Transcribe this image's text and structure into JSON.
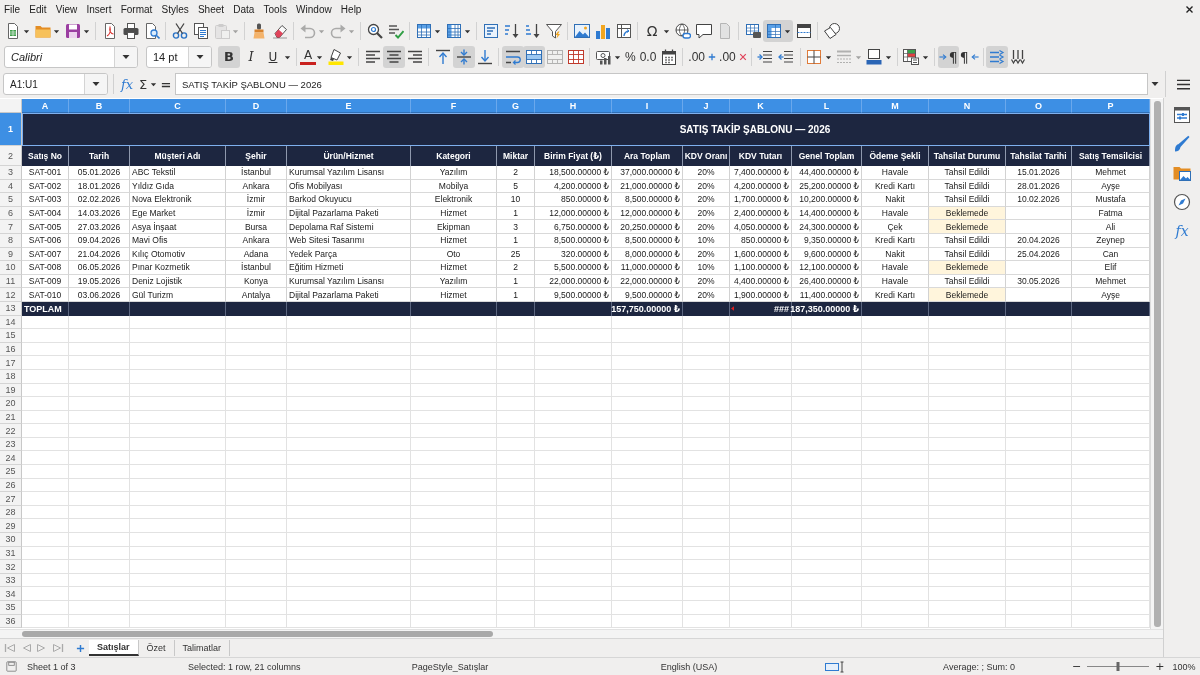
{
  "menu_bar": [
    "File",
    "Edit",
    "View",
    "Insert",
    "Format",
    "Styles",
    "Sheet",
    "Data",
    "Tools",
    "Window",
    "Help"
  ],
  "standard_toolbar": {
    "paste_disabled": true,
    "undo_disabled": true,
    "redo_disabled": true,
    "special_character_glyph": "Ω",
    "freeze_on": true
  },
  "formatting_toolbar": {
    "font_name": "Calibri",
    "font_size": "14 pt",
    "bold": {
      "glyph": "B",
      "on": true
    },
    "italic": {
      "glyph": "I",
      "on": false
    },
    "underline": {
      "glyph": "U",
      "on": false
    },
    "font_color_glyph": "A",
    "align_left": false,
    "align_center": true,
    "align_right": false,
    "align_top": false,
    "align_middle": true,
    "align_bottom": false,
    "wrap_text": true,
    "merge_and_center": true,
    "merge_cells_disabled": true,
    "percent_glyph": "%",
    "decimal_glyph": "0.0",
    "add_decimal_glyph": ".00",
    "delete_decimal_glyph": ".00",
    "border_style_disabled": true,
    "left_to_right": {
      "glyph": "¶",
      "on": true
    },
    "right_to_left": {
      "glyph": "¶",
      "on": false
    },
    "text_direction_horizontal": true,
    "text_direction_vertical": false
  },
  "formula_bar": {
    "name_box": "A1:U1",
    "function_glyph": "fx",
    "sum_glyph": "Σ",
    "equals_glyph": "=",
    "content": "SATIŞ TAKİP ŞABLONU — 2026"
  },
  "sheet": {
    "column_headers": [
      {
        "label": "A",
        "selected": true
      },
      {
        "label": "B",
        "selected": true
      },
      {
        "label": "C",
        "selected": true
      },
      {
        "label": "D",
        "selected": true
      },
      {
        "label": "E",
        "selected": true
      },
      {
        "label": "F",
        "selected": true
      },
      {
        "label": "G",
        "selected": true
      },
      {
        "label": "H",
        "selected": true
      },
      {
        "label": "I",
        "selected": true
      },
      {
        "label": "J",
        "selected": true
      },
      {
        "label": "K",
        "selected": true
      },
      {
        "label": "L",
        "selected": true
      },
      {
        "label": "M",
        "selected": true
      },
      {
        "label": "N",
        "selected": true
      },
      {
        "label": "O",
        "selected": true
      },
      {
        "label": "P",
        "selected": true
      }
    ],
    "row_headers": [
      {
        "label": "1",
        "selected": true
      },
      {
        "label": "2",
        "selected": false
      },
      {
        "label": "3",
        "selected": false
      },
      {
        "label": "4",
        "selected": false
      },
      {
        "label": "5",
        "selected": false
      },
      {
        "label": "6",
        "selected": false
      },
      {
        "label": "7",
        "selected": false
      },
      {
        "label": "8",
        "selected": false
      },
      {
        "label": "9",
        "selected": false
      },
      {
        "label": "10",
        "selected": false
      },
      {
        "label": "11",
        "selected": false
      },
      {
        "label": "12",
        "selected": false
      },
      {
        "label": "13",
        "selected": false
      },
      {
        "label": "14",
        "selected": false
      },
      {
        "label": "15",
        "selected": false
      },
      {
        "label": "16",
        "selected": false
      },
      {
        "label": "17",
        "selected": false
      },
      {
        "label": "18",
        "selected": false
      },
      {
        "label": "19",
        "selected": false
      },
      {
        "label": "20",
        "selected": false
      },
      {
        "label": "21",
        "selected": false
      },
      {
        "label": "22",
        "selected": false
      },
      {
        "label": "23",
        "selected": false
      },
      {
        "label": "24",
        "selected": false
      },
      {
        "label": "25",
        "selected": false
      },
      {
        "label": "26",
        "selected": false
      },
      {
        "label": "27",
        "selected": false
      },
      {
        "label": "28",
        "selected": false
      },
      {
        "label": "29",
        "selected": false
      },
      {
        "label": "30",
        "selected": false
      },
      {
        "label": "31",
        "selected": false
      },
      {
        "label": "32",
        "selected": false
      },
      {
        "label": "33",
        "selected": false
      },
      {
        "label": "34",
        "selected": false
      },
      {
        "label": "35",
        "selected": false
      },
      {
        "label": "36",
        "selected": false
      }
    ],
    "title": "SATIŞ TAKİP ŞABLONU — 2026",
    "columns": [
      "Satış No",
      "Tarih",
      "Müşteri Adı",
      "Şehir",
      "Ürün/Hizmet",
      "Kategori",
      "Miktar",
      "Birim Fiyat (₺)",
      "Ara Toplam",
      "KDV Oranı",
      "KDV Tutarı",
      "Genel Toplam",
      "Ödeme Şekli",
      "Tahsilat Durumu",
      "Tahsilat Tarihi",
      "Satış Temsilcisi"
    ],
    "rows": [
      {
        "sale_no": "SAT-001",
        "date": "05.01.2026",
        "customer": "ABC Tekstil",
        "city": "İstanbul",
        "product": "Kurumsal Yazılım Lisansı",
        "category": "Yazılım",
        "quantity": "2",
        "unit_price": "18,500.00000 ₺",
        "subtotal": "37,000.00000 ₺",
        "vat_rate": "20%",
        "vat_amount": "7,400.00000 ₺",
        "grand_total": "44,400.00000 ₺",
        "payment_method": "Havale",
        "collection_status": "Tahsil Edildi",
        "collection_date": "15.01.2026",
        "sales_rep": "Mehmet",
        "status_highlighted": false
      },
      {
        "sale_no": "SAT-002",
        "date": "18.01.2026",
        "customer": "Yıldız Gıda",
        "city": "Ankara",
        "product": "Ofis Mobilyası",
        "category": "Mobilya",
        "quantity": "5",
        "unit_price": "4,200.00000 ₺",
        "subtotal": "21,000.00000 ₺",
        "vat_rate": "20%",
        "vat_amount": "4,200.00000 ₺",
        "grand_total": "25,200.00000 ₺",
        "payment_method": "Kredi Kartı",
        "collection_status": "Tahsil Edildi",
        "collection_date": "28.01.2026",
        "sales_rep": "Ayşe",
        "status_highlighted": false
      },
      {
        "sale_no": "SAT-003",
        "date": "02.02.2026",
        "customer": "Nova Elektronik",
        "city": "İzmir",
        "product": "Barkod Okuyucu",
        "category": "Elektronik",
        "quantity": "10",
        "unit_price": "850.00000 ₺",
        "subtotal": "8,500.00000 ₺",
        "vat_rate": "20%",
        "vat_amount": "1,700.00000 ₺",
        "grand_total": "10,200.00000 ₺",
        "payment_method": "Nakit",
        "collection_status": "Tahsil Edildi",
        "collection_date": "10.02.2026",
        "sales_rep": "Mustafa",
        "status_highlighted": false
      },
      {
        "sale_no": "SAT-004",
        "date": "14.03.2026",
        "customer": "Ege Market",
        "city": "İzmir",
        "product": "Dijital Pazarlama Paketi",
        "category": "Hizmet",
        "quantity": "1",
        "unit_price": "12,000.00000 ₺",
        "subtotal": "12,000.00000 ₺",
        "vat_rate": "20%",
        "vat_amount": "2,400.00000 ₺",
        "grand_total": "14,400.00000 ₺",
        "payment_method": "Havale",
        "collection_status": "Beklemede",
        "sales_rep": "Fatma",
        "status_highlighted": true
      },
      {
        "sale_no": "SAT-005",
        "date": "27.03.2026",
        "customer": "Asya İnşaat",
        "city": "Bursa",
        "product": "Depolama Raf Sistemi",
        "category": "Ekipman",
        "quantity": "3",
        "unit_price": "6,750.00000 ₺",
        "subtotal": "20,250.00000 ₺",
        "vat_rate": "20%",
        "vat_amount": "4,050.00000 ₺",
        "grand_total": "24,300.00000 ₺",
        "payment_method": "Çek",
        "collection_status": "Beklemede",
        "sales_rep": "Ali",
        "status_highlighted": true
      },
      {
        "sale_no": "SAT-006",
        "date": "09.04.2026",
        "customer": "Mavi Ofis",
        "city": "Ankara",
        "product": "Web Sitesi Tasarımı",
        "category": "Hizmet",
        "quantity": "1",
        "unit_price": "8,500.00000 ₺",
        "subtotal": "8,500.00000 ₺",
        "vat_rate": "10%",
        "vat_amount": "850.00000 ₺",
        "grand_total": "9,350.00000 ₺",
        "payment_method": "Kredi Kartı",
        "collection_status": "Tahsil Edildi",
        "collection_date": "20.04.2026",
        "sales_rep": "Zeynep",
        "status_highlighted": false
      },
      {
        "sale_no": "SAT-007",
        "date": "21.04.2026",
        "customer": "Kılıç Otomotiv",
        "city": "Adana",
        "product": "Yedek Parça",
        "category": "Oto",
        "quantity": "25",
        "unit_price": "320.00000 ₺",
        "subtotal": "8,000.00000 ₺",
        "vat_rate": "20%",
        "vat_amount": "1,600.00000 ₺",
        "grand_total": "9,600.00000 ₺",
        "payment_method": "Nakit",
        "collection_status": "Tahsil Edildi",
        "collection_date": "25.04.2026",
        "sales_rep": "Can",
        "status_highlighted": false
      },
      {
        "sale_no": "SAT-008",
        "date": "06.05.2026",
        "customer": "Pınar Kozmetik",
        "city": "İstanbul",
        "product": "Eğitim Hizmeti",
        "category": "Hizmet",
        "quantity": "2",
        "unit_price": "5,500.00000 ₺",
        "subtotal": "11,000.00000 ₺",
        "vat_rate": "10%",
        "vat_amount": "1,100.00000 ₺",
        "grand_total": "12,100.00000 ₺",
        "payment_method": "Havale",
        "collection_status": "Beklemede",
        "sales_rep": "Elif",
        "status_highlighted": true
      },
      {
        "sale_no": "SAT-009",
        "date": "19.05.2026",
        "customer": "Deniz Lojistik",
        "city": "Konya",
        "product": "Kurumsal Yazılım Lisansı",
        "category": "Yazılım",
        "quantity": "1",
        "unit_price": "22,000.00000 ₺",
        "subtotal": "22,000.00000 ₺",
        "vat_rate": "20%",
        "vat_amount": "4,400.00000 ₺",
        "grand_total": "26,400.00000 ₺",
        "payment_method": "Havale",
        "collection_status": "Tahsil Edildi",
        "collection_date": "30.05.2026",
        "sales_rep": "Mehmet",
        "status_highlighted": false
      },
      {
        "sale_no": "SAT-010",
        "date": "03.06.2026",
        "customer": "Gül Turizm",
        "city": "Antalya",
        "product": "Dijital Pazarlama Paketi",
        "category": "Hizmet",
        "quantity": "1",
        "unit_price": "9,500.00000 ₺",
        "subtotal": "9,500.00000 ₺",
        "vat_rate": "20%",
        "vat_amount": "1,900.00000 ₺",
        "grand_total": "11,400.00000 ₺",
        "payment_method": "Kredi Kartı",
        "collection_status": "Beklemede",
        "sales_rep": "Ayşe",
        "status_highlighted": true
      }
    ],
    "total_row": {
      "label": "TOPLAM",
      "subtotal": "157,750.00000 ₺",
      "vat_amount": "###",
      "vat_amount_overflow": true,
      "grand_total": "187,350.00000 ₺"
    }
  },
  "sheet_tabs": [
    {
      "label": "Satışlar",
      "selected": true
    },
    {
      "label": "Özet",
      "selected": false
    },
    {
      "label": "Talimatlar",
      "selected": false
    }
  ],
  "sidebar": {
    "functions_glyph": "fx"
  },
  "status_bar": {
    "sheet": "Sheet 1 of 3",
    "selection": "Selected: 1 row, 21 columns",
    "page_style": "PageStyle_Satışlar",
    "language": "English (USA)",
    "summary": "Average: ; Sum: 0",
    "zoom": {
      "out_glyph": "−",
      "in_glyph": "+",
      "level": 0.5,
      "label": "100%"
    }
  }
}
